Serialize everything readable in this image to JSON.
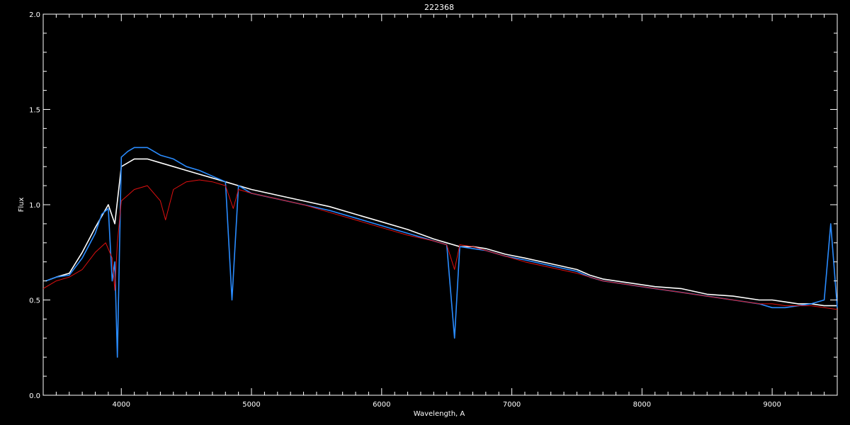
{
  "chart_data": {
    "type": "line",
    "title": "222368",
    "xlabel": "Wavelength, A",
    "ylabel": "Flux",
    "xlim": [
      3400,
      9500
    ],
    "ylim": [
      0.0,
      2.0
    ],
    "x_ticks": [
      4000,
      5000,
      6000,
      7000,
      8000,
      9000
    ],
    "x_tick_labels": [
      "4000",
      "5000",
      "6000",
      "7000",
      "8000",
      "9000"
    ],
    "y_ticks": [
      0.0,
      0.5,
      1.0,
      1.5,
      2.0
    ],
    "y_tick_labels": [
      "0.0",
      "0.5",
      "1.0",
      "1.5",
      "2.0"
    ],
    "grid": false,
    "background": "#000000",
    "series": [
      {
        "color": "#ffffff",
        "x": [
          3420,
          3500,
          3600,
          3700,
          3800,
          3900,
          3950,
          4000,
          4100,
          4200,
          4300,
          4400,
          4500,
          4600,
          4700,
          4800,
          4900,
          5000,
          5200,
          5400,
          5600,
          5800,
          6000,
          6200,
          6400,
          6500,
          6600,
          6700,
          6800,
          6950,
          7100,
          7300,
          7500,
          7600,
          7700,
          7900,
          8100,
          8300,
          8500,
          8700,
          8900,
          9000,
          9100,
          9200,
          9300,
          9400,
          9500
        ],
        "y": [
          0.6,
          0.62,
          0.64,
          0.75,
          0.88,
          1.0,
          0.9,
          1.2,
          1.24,
          1.24,
          1.22,
          1.2,
          1.18,
          1.16,
          1.14,
          1.12,
          1.1,
          1.08,
          1.05,
          1.02,
          0.99,
          0.95,
          0.91,
          0.87,
          0.82,
          0.8,
          0.78,
          0.78,
          0.77,
          0.74,
          0.72,
          0.69,
          0.66,
          0.63,
          0.61,
          0.59,
          0.57,
          0.56,
          0.53,
          0.52,
          0.5,
          0.5,
          0.49,
          0.48,
          0.48,
          0.47,
          0.47
        ]
      },
      {
        "color": "#2a8cff",
        "x": [
          3420,
          3500,
          3600,
          3700,
          3800,
          3850,
          3900,
          3930,
          3950,
          3970,
          4000,
          4050,
          4100,
          4200,
          4300,
          4400,
          4500,
          4600,
          4700,
          4800,
          4850,
          4900,
          5000,
          5200,
          5400,
          5600,
          5800,
          6000,
          6200,
          6400,
          6500,
          6560,
          6600,
          6700,
          6800,
          6950,
          7100,
          7300,
          7500,
          7600,
          7700,
          7900,
          8100,
          8300,
          8500,
          8700,
          8900,
          9000,
          9100,
          9200,
          9300,
          9400,
          9450,
          9500
        ],
        "y": [
          0.6,
          0.62,
          0.63,
          0.72,
          0.85,
          0.95,
          0.98,
          0.6,
          0.7,
          0.2,
          1.25,
          1.28,
          1.3,
          1.3,
          1.26,
          1.24,
          1.2,
          1.18,
          1.15,
          1.12,
          0.5,
          1.1,
          1.06,
          1.03,
          1.0,
          0.97,
          0.93,
          0.89,
          0.85,
          0.81,
          0.79,
          0.3,
          0.78,
          0.77,
          0.76,
          0.73,
          0.71,
          0.68,
          0.65,
          0.62,
          0.6,
          0.58,
          0.56,
          0.54,
          0.52,
          0.5,
          0.48,
          0.46,
          0.46,
          0.47,
          0.48,
          0.5,
          0.9,
          0.46
        ]
      },
      {
        "color": "#e01010",
        "x": [
          3400,
          3500,
          3600,
          3700,
          3800,
          3880,
          3930,
          3950,
          3970,
          4000,
          4050,
          4100,
          4200,
          4300,
          4340,
          4400,
          4500,
          4600,
          4700,
          4800,
          4860,
          4900,
          5000,
          5200,
          5400,
          5600,
          5800,
          6000,
          6200,
          6400,
          6500,
          6560,
          6600,
          6700,
          6800,
          6950,
          7100,
          7300,
          7500,
          7600,
          7700,
          7900,
          8100,
          8300,
          8500,
          8700,
          8900,
          9000,
          9100,
          9200,
          9300,
          9400,
          9500
        ],
        "y": [
          0.56,
          0.6,
          0.62,
          0.66,
          0.75,
          0.8,
          0.72,
          0.55,
          0.8,
          1.02,
          1.05,
          1.08,
          1.1,
          1.02,
          0.92,
          1.08,
          1.12,
          1.13,
          1.12,
          1.1,
          0.98,
          1.08,
          1.06,
          1.03,
          1.0,
          0.96,
          0.92,
          0.88,
          0.84,
          0.81,
          0.79,
          0.66,
          0.79,
          0.78,
          0.76,
          0.73,
          0.7,
          0.67,
          0.64,
          0.62,
          0.6,
          0.58,
          0.56,
          0.54,
          0.52,
          0.5,
          0.48,
          0.48,
          0.47,
          0.47,
          0.47,
          0.46,
          0.45
        ]
      }
    ]
  }
}
